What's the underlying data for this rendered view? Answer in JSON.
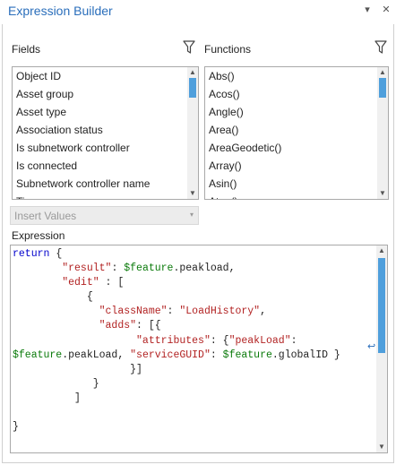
{
  "window": {
    "title": "Expression Builder",
    "pin_glyph": "▾",
    "close_glyph": "✕"
  },
  "fields": {
    "label": "Fields",
    "filter_icon": "filter-icon",
    "items": [
      "Object ID",
      "Asset group",
      "Asset type",
      "Association status",
      "Is subnetwork controller",
      "Is connected",
      "Subnetwork controller name",
      "Tier"
    ],
    "scroll_position": 0.0
  },
  "functions": {
    "label": "Functions",
    "filter_icon": "filter-icon",
    "items": [
      "Abs()",
      "Acos()",
      "Angle()",
      "Area()",
      "AreaGeodetic()",
      "Array()",
      "Asin()",
      "Atan()"
    ],
    "scroll_position": 0.0
  },
  "insert_values": {
    "label": "Insert Values",
    "caret": "▾",
    "enabled": false
  },
  "expression": {
    "label": "Expression",
    "wrap_glyph": "↩",
    "lines": [
      [
        {
          "t": "kw",
          "v": "return"
        },
        {
          "t": "plain",
          "v": " {"
        }
      ],
      [
        {
          "t": "plain",
          "v": "        "
        },
        {
          "t": "str",
          "v": "\"result\""
        },
        {
          "t": "plain",
          "v": ": "
        },
        {
          "t": "var",
          "v": "$feature"
        },
        {
          "t": "plain",
          "v": ".peakload,"
        }
      ],
      [
        {
          "t": "plain",
          "v": "        "
        },
        {
          "t": "str",
          "v": "\"edit\""
        },
        {
          "t": "plain",
          "v": " : ["
        }
      ],
      [
        {
          "t": "plain",
          "v": "            {"
        }
      ],
      [
        {
          "t": "plain",
          "v": "              "
        },
        {
          "t": "str",
          "v": "\"className\""
        },
        {
          "t": "plain",
          "v": ": "
        },
        {
          "t": "str",
          "v": "\"LoadHistory\""
        },
        {
          "t": "plain",
          "v": ","
        }
      ],
      [
        {
          "t": "plain",
          "v": "              "
        },
        {
          "t": "str",
          "v": "\"adds\""
        },
        {
          "t": "plain",
          "v": ": [{"
        }
      ],
      [
        {
          "t": "plain",
          "v": "                    "
        },
        {
          "t": "str",
          "v": "\"attributes\""
        },
        {
          "t": "plain",
          "v": ": {"
        },
        {
          "t": "str",
          "v": "\"peakLoad\""
        },
        {
          "t": "plain",
          "v": ":"
        }
      ],
      [
        {
          "t": "var",
          "v": "$feature"
        },
        {
          "t": "plain",
          "v": ".peakLoad, "
        },
        {
          "t": "str",
          "v": "\"serviceGUID\""
        },
        {
          "t": "plain",
          "v": ": "
        },
        {
          "t": "var",
          "v": "$feature"
        },
        {
          "t": "plain",
          "v": ".globalID }"
        }
      ],
      [
        {
          "t": "plain",
          "v": "                   }]"
        }
      ],
      [
        {
          "t": "plain",
          "v": "             }"
        }
      ],
      [
        {
          "t": "plain",
          "v": "          ]"
        }
      ],
      [
        {
          "t": "plain",
          "v": ""
        }
      ],
      [
        {
          "t": "plain",
          "v": "}"
        }
      ]
    ],
    "scroll_position": 0.0
  },
  "colors": {
    "accent": "#2a6ebb",
    "scroll_thumb": "#4f9fdc",
    "keyword": "#0000cc",
    "string": "#b22222",
    "variable": "#0a7a0a"
  }
}
